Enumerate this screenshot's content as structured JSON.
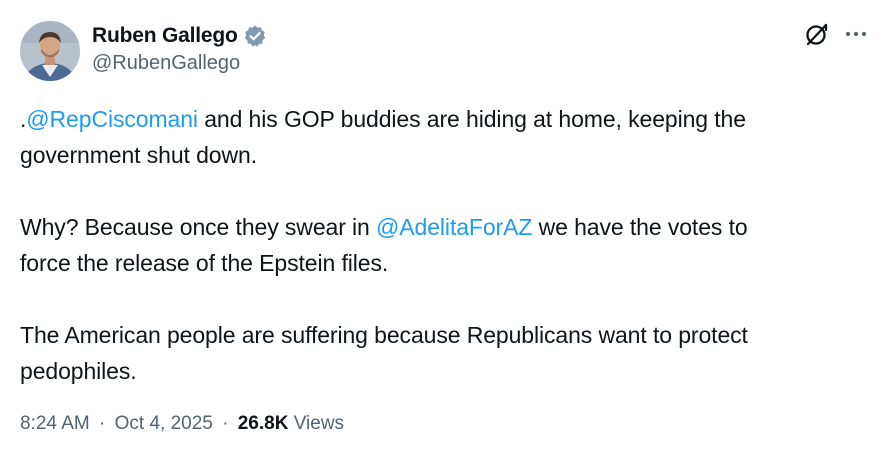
{
  "author": {
    "display_name": "Ruben Gallego",
    "handle": "@RubenGallego",
    "verified": true,
    "verified_color": "#829aab"
  },
  "header_icons": {
    "grok": "grok-icon",
    "more": "more-icon"
  },
  "tweet": {
    "p1_prefix": ".",
    "p1_mention": "@RepCiscomani",
    "p1_rest1": " and his GOP buddies are hiding at home, keeping the",
    "p1_rest2": "government shut down.",
    "p2_before": "Why? Because once they swear in ",
    "p2_mention": "@AdelitaForAZ",
    "p2_after1": " we have the votes to",
    "p2_after2": "force the release of the Epstein files.",
    "p3_line1": "The American people are suffering because Republicans want to protect",
    "p3_line2": "pedophiles."
  },
  "meta": {
    "time": "8:24 AM",
    "separator": "·",
    "date": "Oct 4, 2025",
    "views_count": "26.8K",
    "views_label": "Views"
  },
  "colors": {
    "link": "#1d9bf0",
    "text": "#0f1419",
    "secondary": "#536471"
  }
}
